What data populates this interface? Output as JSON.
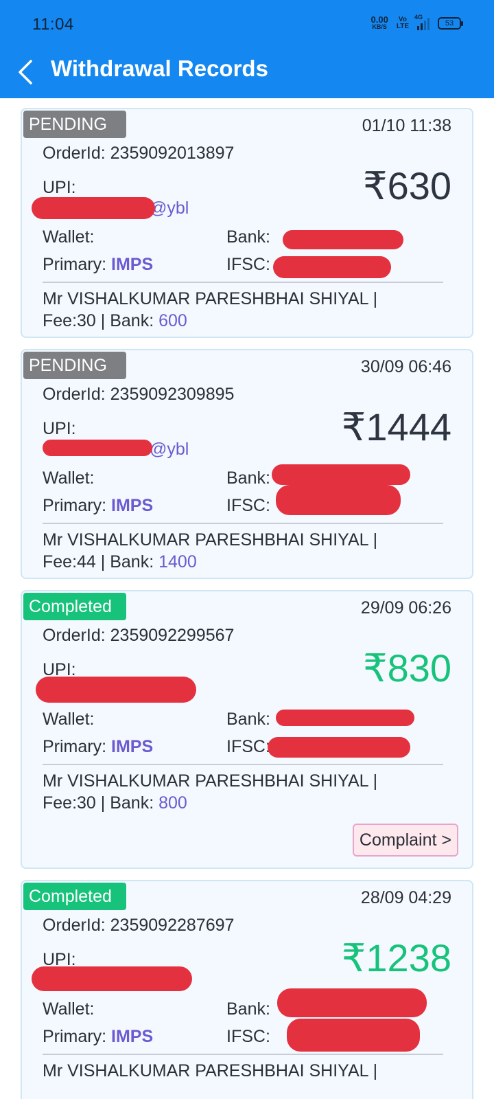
{
  "status_bar": {
    "time": "11:04",
    "net_speed_value": "0.00",
    "net_speed_unit": "KB/S",
    "volte_top": "Vo",
    "volte_bottom": "LTE",
    "network_type": "4G",
    "battery": "53"
  },
  "header": {
    "title": "Withdrawal Records",
    "back_icon": "chevron-left-icon",
    "background_color": "#1488f0"
  },
  "labels": {
    "order_id_prefix": "OrderId: ",
    "upi": "UPI:",
    "wallet": "Wallet:",
    "bank": "Bank:",
    "primary": "Primary: ",
    "ifsc": "IFSC:",
    "fee_prefix": "Fee:",
    "bank_amount_prefix": " | Bank: ",
    "complaint": "Complaint >"
  },
  "colors": {
    "pending": "#7d7f82",
    "completed": "#17c27a",
    "accent_text": "#6a5bd0",
    "redaction": "#e4313f"
  },
  "records": [
    {
      "status": "PENDING",
      "datetime": "01/10 11:38",
      "order_id": "2359092013897",
      "upi_visible": "@ybl",
      "amount": "₹630",
      "primary": "IMPS",
      "name": "Mr VISHALKUMAR PARESHBHAI SHIYAL |",
      "fee": "30",
      "bank_amount": "600"
    },
    {
      "status": "PENDING",
      "datetime": "30/09 06:46",
      "order_id": "2359092309895",
      "upi_visible": "@ybl",
      "amount": "₹1444",
      "primary": "IMPS",
      "name": "Mr VISHALKUMAR PARESHBHAI SHIYAL |",
      "fee": "44",
      "bank_amount": "1400"
    },
    {
      "status": "Completed",
      "datetime": "29/09 06:26",
      "order_id": "2359092299567",
      "upi_visible": "",
      "amount": "₹830",
      "primary": "IMPS",
      "name": "Mr VISHALKUMAR PARESHBHAI SHIYAL |",
      "fee": "30",
      "bank_amount": "800"
    },
    {
      "status": "Completed",
      "datetime": "28/09 04:29",
      "order_id": "2359092287697",
      "upi_visible": "",
      "amount": "₹1238",
      "primary": "IMPS",
      "name": "Mr VISHALKUMAR PARESHBHAI SHIYAL |",
      "fee": "",
      "bank_amount": ""
    }
  ]
}
